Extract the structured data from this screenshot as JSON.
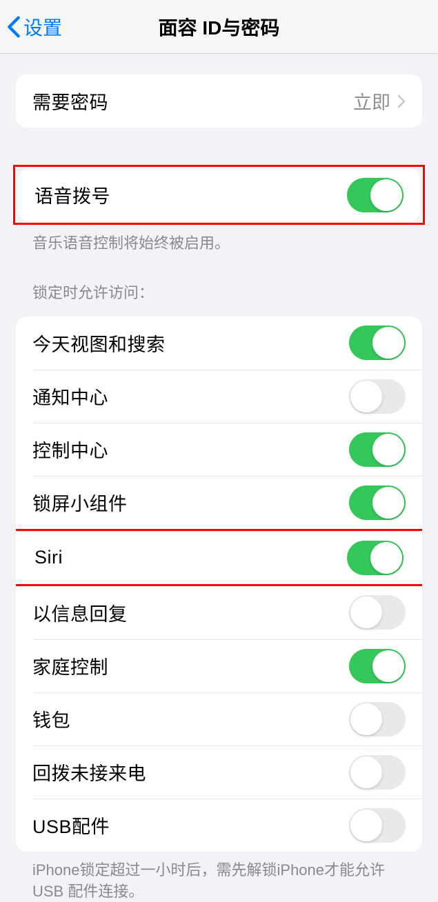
{
  "nav": {
    "back_label": "设置",
    "title": "面容 ID与密码"
  },
  "require_passcode": {
    "label": "需要密码",
    "value": "立即"
  },
  "voice_dial": {
    "label": "语音拨号",
    "on": true,
    "footer": "音乐语音控制将始终被启用。"
  },
  "lock_access": {
    "header": "锁定时允许访问：",
    "items": [
      {
        "label": "今天视图和搜索",
        "on": true
      },
      {
        "label": "通知中心",
        "on": false
      },
      {
        "label": "控制中心",
        "on": true
      },
      {
        "label": "锁屏小组件",
        "on": true
      },
      {
        "label": "Siri",
        "on": true
      },
      {
        "label": "以信息回复",
        "on": false
      },
      {
        "label": "家庭控制",
        "on": true
      },
      {
        "label": "钱包",
        "on": false
      },
      {
        "label": "回拨未接来电",
        "on": false
      },
      {
        "label": "USB配件",
        "on": false
      }
    ],
    "footer": "iPhone锁定超过一小时后，需先解锁iPhone才能允许 USB 配件连接。"
  }
}
